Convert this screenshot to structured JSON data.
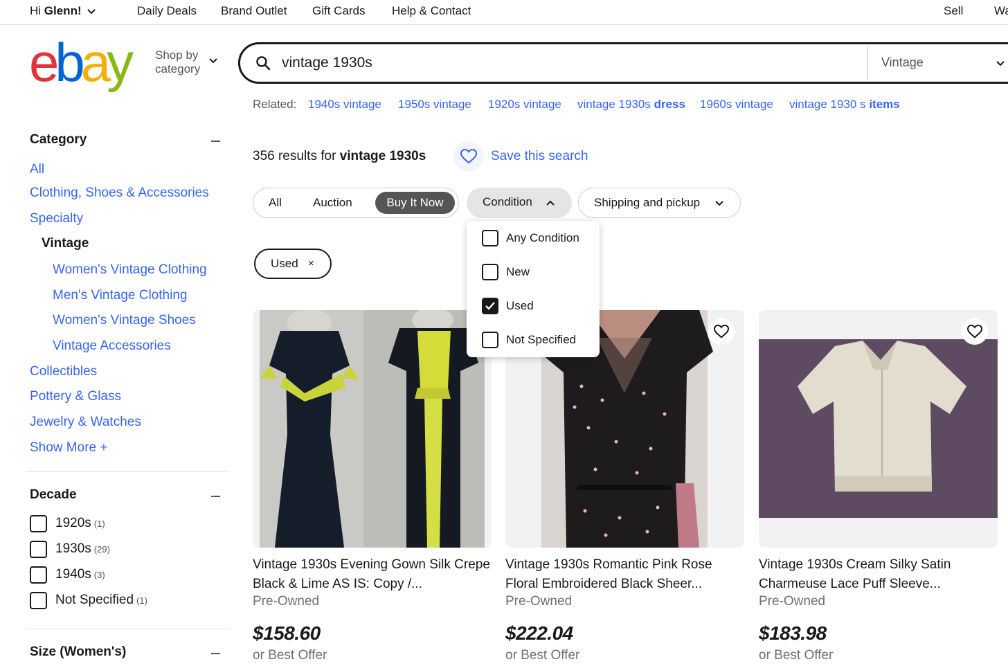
{
  "topbar": {
    "greeting_prefix": "Hi ",
    "greeting_name": "Glenn!",
    "links": [
      "Daily Deals",
      "Brand Outlet",
      "Gift Cards",
      "Help & Contact"
    ],
    "sell": "Sell",
    "watchlist_partial": "Wa"
  },
  "header": {
    "logo_letters": [
      "e",
      "b",
      "a",
      "y"
    ],
    "shop_by_line1": "Shop by",
    "shop_by_line2": "category",
    "search_value": "vintage 1930s",
    "category_select": "Vintage"
  },
  "related": {
    "label": "Related:",
    "links": [
      {
        "plain": "1940s vintage",
        "bold": ""
      },
      {
        "plain": "1950s vintage",
        "bold": ""
      },
      {
        "plain": "1920s vintage",
        "bold": ""
      },
      {
        "plain": "vintage 1930s ",
        "bold": "dress"
      },
      {
        "plain": "1960s vintage",
        "bold": ""
      },
      {
        "plain": "vintage 1930 s ",
        "bold": "items"
      }
    ]
  },
  "sidebar": {
    "category_heading": "Category",
    "categories": {
      "all": "All",
      "clothing": "Clothing, Shoes & Accessories",
      "specialty": "Specialty",
      "current": "Vintage",
      "sub": [
        "Women's Vintage Clothing",
        "Men's Vintage Clothing",
        "Women's Vintage Shoes",
        "Vintage Accessories"
      ],
      "others": [
        "Collectibles",
        "Pottery & Glass",
        "Jewelry & Watches"
      ],
      "show_more": "Show More +"
    },
    "decade_heading": "Decade",
    "decades": [
      {
        "label": "1920s",
        "count": "(1)"
      },
      {
        "label": "1930s",
        "count": "(29)"
      },
      {
        "label": "1940s",
        "count": "(3)"
      },
      {
        "label": "Not Specified",
        "count": "(1)"
      }
    ],
    "size_heading": "Size (Women's)"
  },
  "main": {
    "results_count": "356 results for ",
    "results_query": "vintage 1930s",
    "save_search": "Save this search",
    "format_options": [
      "All",
      "Auction",
      "Buy It Now"
    ],
    "active_format": "Buy It Now",
    "condition_filter": "Condition",
    "shipping_filter": "Shipping and pickup",
    "applied_chip": "Used",
    "applied_chip_close": "×"
  },
  "condition_dropdown": [
    {
      "label": "Any Condition",
      "checked": false
    },
    {
      "label": "New",
      "checked": false
    },
    {
      "label": "Used",
      "checked": true
    },
    {
      "label": "Not Specified",
      "checked": false
    }
  ],
  "listings": [
    {
      "title": "Vintage 1930s Evening Gown Silk Crepe Black & Lime AS IS: Copy /...",
      "condition": "Pre-Owned",
      "price": "$158.60",
      "offer": "or Best Offer"
    },
    {
      "title": "Vintage 1930s Romantic Pink Rose Floral Embroidered Black Sheer...",
      "condition": "Pre-Owned",
      "price": "$222.04",
      "offer": "or Best Offer"
    },
    {
      "title": "Vintage 1930s Cream Silky Satin Charmeuse Lace Puff Sleeve...",
      "condition": "Pre-Owned",
      "price": "$183.98",
      "offer": "or Best Offer"
    }
  ],
  "colors": {
    "link_blue": "#3665f3",
    "text": "#191919",
    "muted": "#707070"
  }
}
